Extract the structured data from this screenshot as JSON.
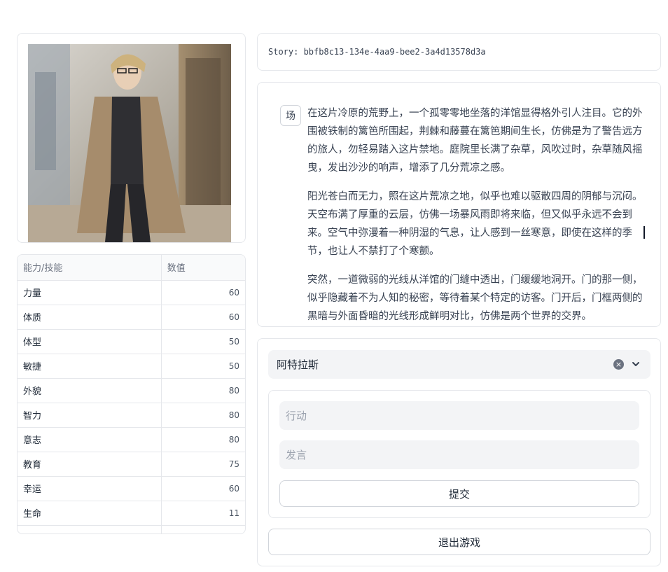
{
  "story": {
    "label": "Story: bbfb8c13-134e-4aa9-bee2-3a4d13578d3a"
  },
  "stats": {
    "headers": [
      "能力/技能",
      "数值"
    ],
    "rows": [
      {
        "name": "力量",
        "value": "60"
      },
      {
        "name": "体质",
        "value": "60"
      },
      {
        "name": "体型",
        "value": "50"
      },
      {
        "name": "敏捷",
        "value": "50"
      },
      {
        "name": "外貌",
        "value": "80"
      },
      {
        "name": "智力",
        "value": "80"
      },
      {
        "name": "意志",
        "value": "80"
      },
      {
        "name": "教育",
        "value": "75"
      },
      {
        "name": "幸运",
        "value": "60"
      },
      {
        "name": "生命",
        "value": "11"
      }
    ]
  },
  "narrative": {
    "badge": "场",
    "paragraphs": [
      "在这片冷原的荒野上，一个孤零零地坐落的洋馆显得格外引人注目。它的外围被铁制的篱笆所围起，荆棘和藤蔓在篱笆期间生长，仿佛是为了警告远方的旅人，勿轻易踏入这片禁地。庭院里长满了杂草，风吹过时，杂草随风摇曳，发出沙沙的响声，增添了几分荒凉之感。",
      "阳光苍白而无力，照在这片荒凉之地，似乎也难以驱散四周的阴郁与沉闷。天空布满了厚重的云层，仿佛一场暴风雨即将来临，但又似乎永远不会到来。空气中弥漫着一种阴湿的气息，让人感到一丝寒意，即使在这样的季节，也让人不禁打了个寒颤。",
      "突然，一道微弱的光线从洋馆的门缝中透出，门缓缓地洞开。门的那一侧，似乎隐藏着不为人知的秘密，等待着某个特定的访客。门开后，门框两侧的黑暗与外面昏暗的光线形成鲜明对比，仿佛是两个世界的交界。"
    ]
  },
  "controls": {
    "character": "阿特拉斯",
    "clear_icon": "clear-icon",
    "action_placeholder": "行动",
    "speech_placeholder": "发言",
    "submit_label": "提交",
    "exit_label": "退出游戏"
  }
}
